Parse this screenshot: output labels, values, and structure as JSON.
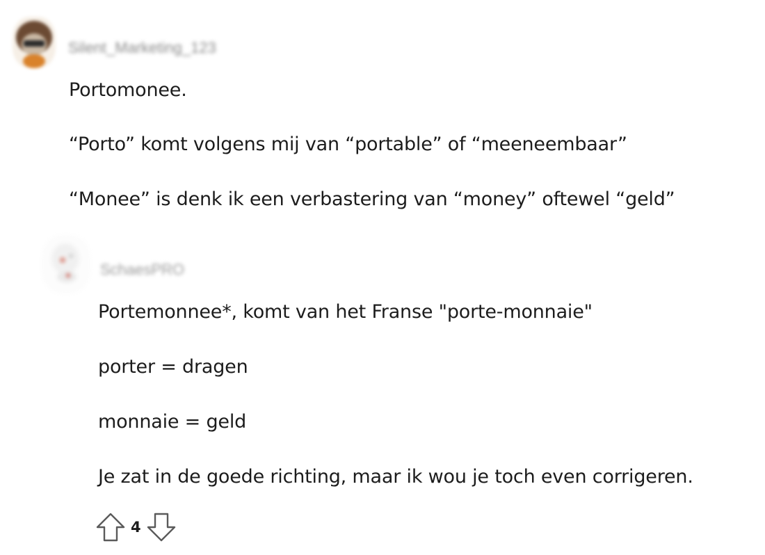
{
  "comments": [
    {
      "username": "Silent_Marketing_123",
      "paragraphs": [
        "Portomonee.",
        "“Porto” komt volgens mij van “portable” of “meeneembaar”",
        "“Monee” is denk ik een verbastering van “money” oftewel “geld”"
      ]
    },
    {
      "username": "SchaesPRO",
      "paragraphs": [
        "Portemonnee*, komt van het Franse \"porte-monnaie\"",
        "porter = dragen",
        "monnaie = geld",
        "Je zat in de goede richting, maar ik wou je toch even corrigeren."
      ],
      "votes": {
        "score": "4",
        "upvote_icon": "arrow-up-outline-icon",
        "downvote_icon": "arrow-down-outline-icon"
      }
    }
  ],
  "colors": {
    "text": "#1c1c1c",
    "username_blurred": "#8a8a8a",
    "icon_stroke": "#5a5a5a"
  }
}
